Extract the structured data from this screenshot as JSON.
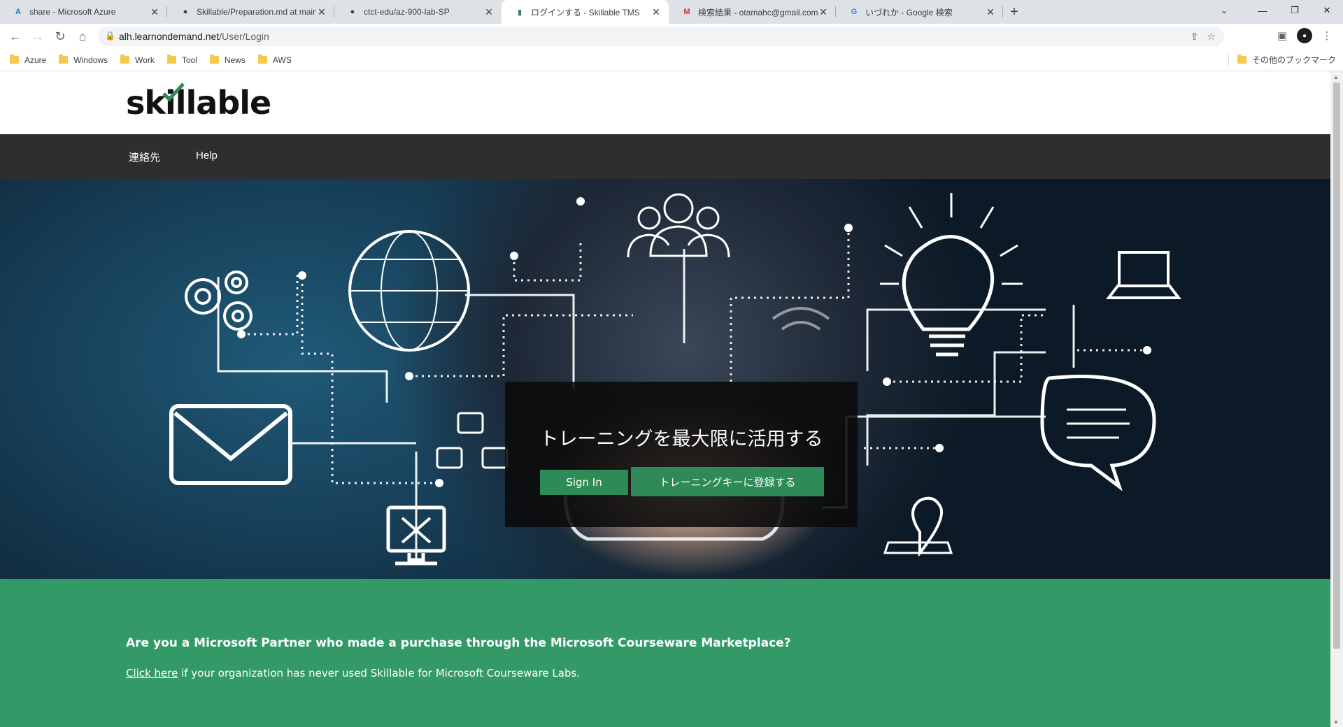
{
  "browser": {
    "tabs": [
      {
        "title": "share - Microsoft Azure",
        "favicon": "azure-icon",
        "active": false
      },
      {
        "title": "Skillable/Preparation.md at main",
        "favicon": "github-icon",
        "active": false
      },
      {
        "title": "ctct-edu/az-900-lab-SP",
        "favicon": "github-icon",
        "active": false
      },
      {
        "title": "ログインする - Skillable TMS",
        "favicon": "skillable-icon",
        "active": true
      },
      {
        "title": "検索結果 - otamahc@gmail.com",
        "favicon": "gmail-icon",
        "active": false
      },
      {
        "title": "いづれか - Google 検索",
        "favicon": "google-icon",
        "active": false
      }
    ],
    "url_domain": "alh.learnondemand.net",
    "url_path": "/User/Login",
    "bookmarks": [
      "Azure",
      "Windows",
      "Work",
      "Tool",
      "News",
      "AWS"
    ],
    "other_bookmarks": "その他のブックマーク"
  },
  "site": {
    "logo_text": "skillable",
    "accent": "#2e8b57",
    "nav": [
      {
        "label": "連絡先"
      },
      {
        "label": "Help"
      }
    ],
    "hero": {
      "title": "トレーニングを最大限に活用する",
      "signin_label": "Sign In",
      "register_label": "トレーニングキーに登録する"
    },
    "partner": {
      "heading": "Are you a Microsoft Partner who made a purchase through the Microsoft Courseware Marketplace?",
      "link_text": "Click here",
      "text": " if your organization has never used Skillable for Microsoft Courseware Labs."
    }
  }
}
